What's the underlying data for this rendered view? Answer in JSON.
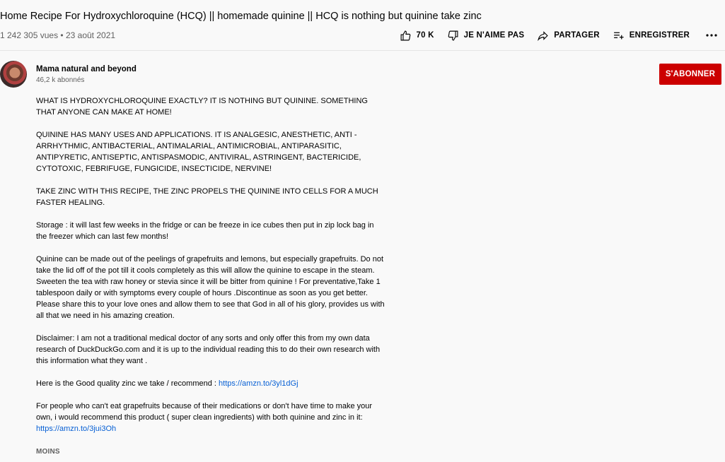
{
  "video": {
    "title": "Home Recipe For Hydroxychloroquine (HCQ) || homemade quinine || HCQ is nothing but quinine take zinc",
    "views": "1 242 305 vues",
    "separator": "•",
    "date": "23 août 2021"
  },
  "actions": {
    "like": {
      "label": "70 K",
      "icon": "thumb-up-icon"
    },
    "dislike": {
      "label": "JE N'AIME PAS",
      "icon": "thumb-down-icon"
    },
    "share": {
      "label": "PARTAGER",
      "icon": "share-icon"
    },
    "save": {
      "label": "ENREGISTRER",
      "icon": "playlist-add-icon"
    },
    "more": {
      "icon": "more-horizontal-icon"
    }
  },
  "channel": {
    "name": "Mama natural and beyond",
    "subscribers": "46,2 k abonnés",
    "subscribe_label": "S'ABONNER"
  },
  "description": {
    "p1": "WHAT IS HYDROXYCHLOROQUINE EXACTLY? IT IS NOTHING BUT QUININE. SOMETHING THAT ANYONE CAN MAKE AT HOME!",
    "p2": "QUININE HAS MANY USES AND APPLICATIONS. IT IS ANALGESIC, ANESTHETIC, ANTI -ARRHYTHMIC, ANTIBACTERIAL, ANTIMALARIAL, ANTIMICROBIAL, ANTIPARASITIC, ANTIPYRETIC, ANTISEPTIC, ANTISPASMODIC, ANTIVIRAL, ASTRINGENT, BACTERICIDE, CYTOTOXIC, FEBRIFUGE, FUNGICIDE, INSECTICIDE, NERVINE!",
    "p3": "TAKE ZINC WITH THIS RECIPE, THE ZINC PROPELS THE QUININE INTO CELLS FOR A MUCH FASTER HEALING.",
    "p4": "Storage : it will last few weeks in the fridge or can be freeze in ice cubes then put in zip lock bag in the freezer which can last few months!",
    "p5": "Quinine can be made out of the peelings of grapefruits and lemons, but especially grapefruits. Do not take the lid off of the pot till it cools completely as this will allow the quinine to escape in the steam. Sweeten the tea with raw honey or stevia since it will be bitter from quinine ! For preventative,Take 1 tablespoon daily or with symptoms every couple of hours .Discontinue as soon as you get better. Please share this to your love ones and allow them to see that God in all of his glory, provides us with all that we need in his amazing creation.",
    "p6": "Disclaimer: I am not a traditional medical doctor of any sorts and only offer this from my own data research of DuckDuckGo.com and it is up to the individual reading this to do their own research with this information what they want .",
    "p7_text": "Here is the Good quality zinc we take / recommend : ",
    "p7_link": "https://amzn.to/3yl1dGj",
    "p8_text": "For people who can't eat grapefruits because of their medications or don't have time to make your own, i would recommend this product ( super clean ingredients) with both quinine and zinc in it:",
    "p8_link": "https://amzn.to/3jui3Oh",
    "less_label": "MOINS"
  },
  "colors": {
    "subscribe_bg": "#cc0000",
    "link": "#065fd4",
    "secondary_text": "#606060"
  }
}
